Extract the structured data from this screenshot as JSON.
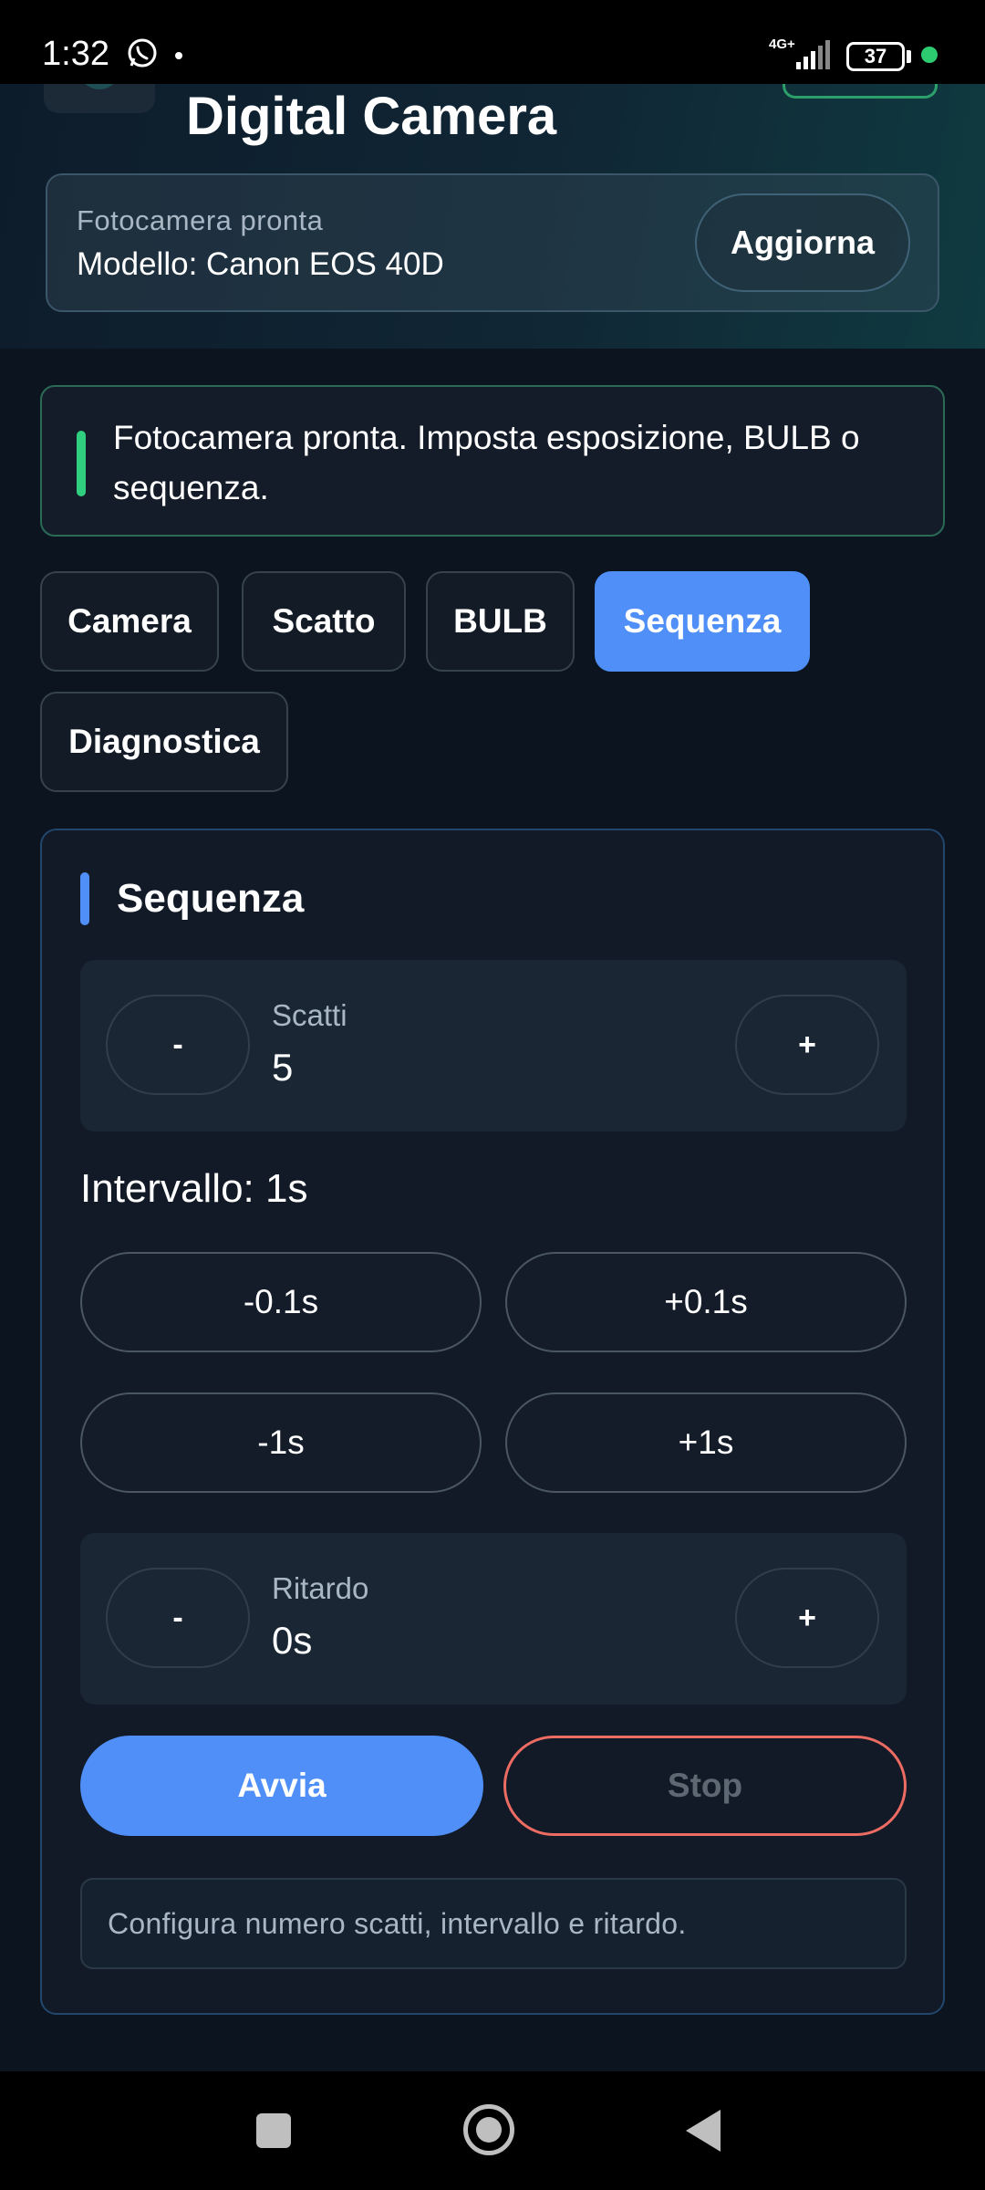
{
  "status_bar": {
    "time": "1:32",
    "network": "4G+",
    "battery": "37",
    "icons": [
      "whatsapp-icon",
      "signal-icon",
      "battery-icon"
    ]
  },
  "header": {
    "title": "Digital Camera",
    "status_label": "Fotocamera pronta",
    "model_text": "Modello: Canon EOS 40D",
    "refresh_label": "Aggiorna"
  },
  "banner": {
    "text": "Fotocamera pronta. Imposta esposizione, BULB o sequenza.",
    "accent_color": "#2fcf7f"
  },
  "tabs": [
    {
      "label": "Camera",
      "active": false
    },
    {
      "label": "Scatto",
      "active": false
    },
    {
      "label": "BULB",
      "active": false
    },
    {
      "label": "Sequenza",
      "active": true
    },
    {
      "label": "Diagnostica",
      "active": false
    }
  ],
  "sequence": {
    "title": "Sequenza",
    "shots": {
      "label": "Scatti",
      "value": "5",
      "minus": "-",
      "plus": "+"
    },
    "interval_label": "Intervallo: 1s",
    "interval_buttons": [
      "-0.1s",
      "+0.1s",
      "-1s",
      "+1s"
    ],
    "delay": {
      "label": "Ritardo",
      "value": "0s",
      "minus": "-",
      "plus": "+"
    },
    "start_label": "Avvia",
    "stop_label": "Stop",
    "hint": "Configura numero scatti, intervallo e ritardo."
  },
  "colors": {
    "accent": "#4f8ff7",
    "success": "#2fcf7f",
    "danger": "#ec6b63",
    "background": "#0b141f"
  }
}
